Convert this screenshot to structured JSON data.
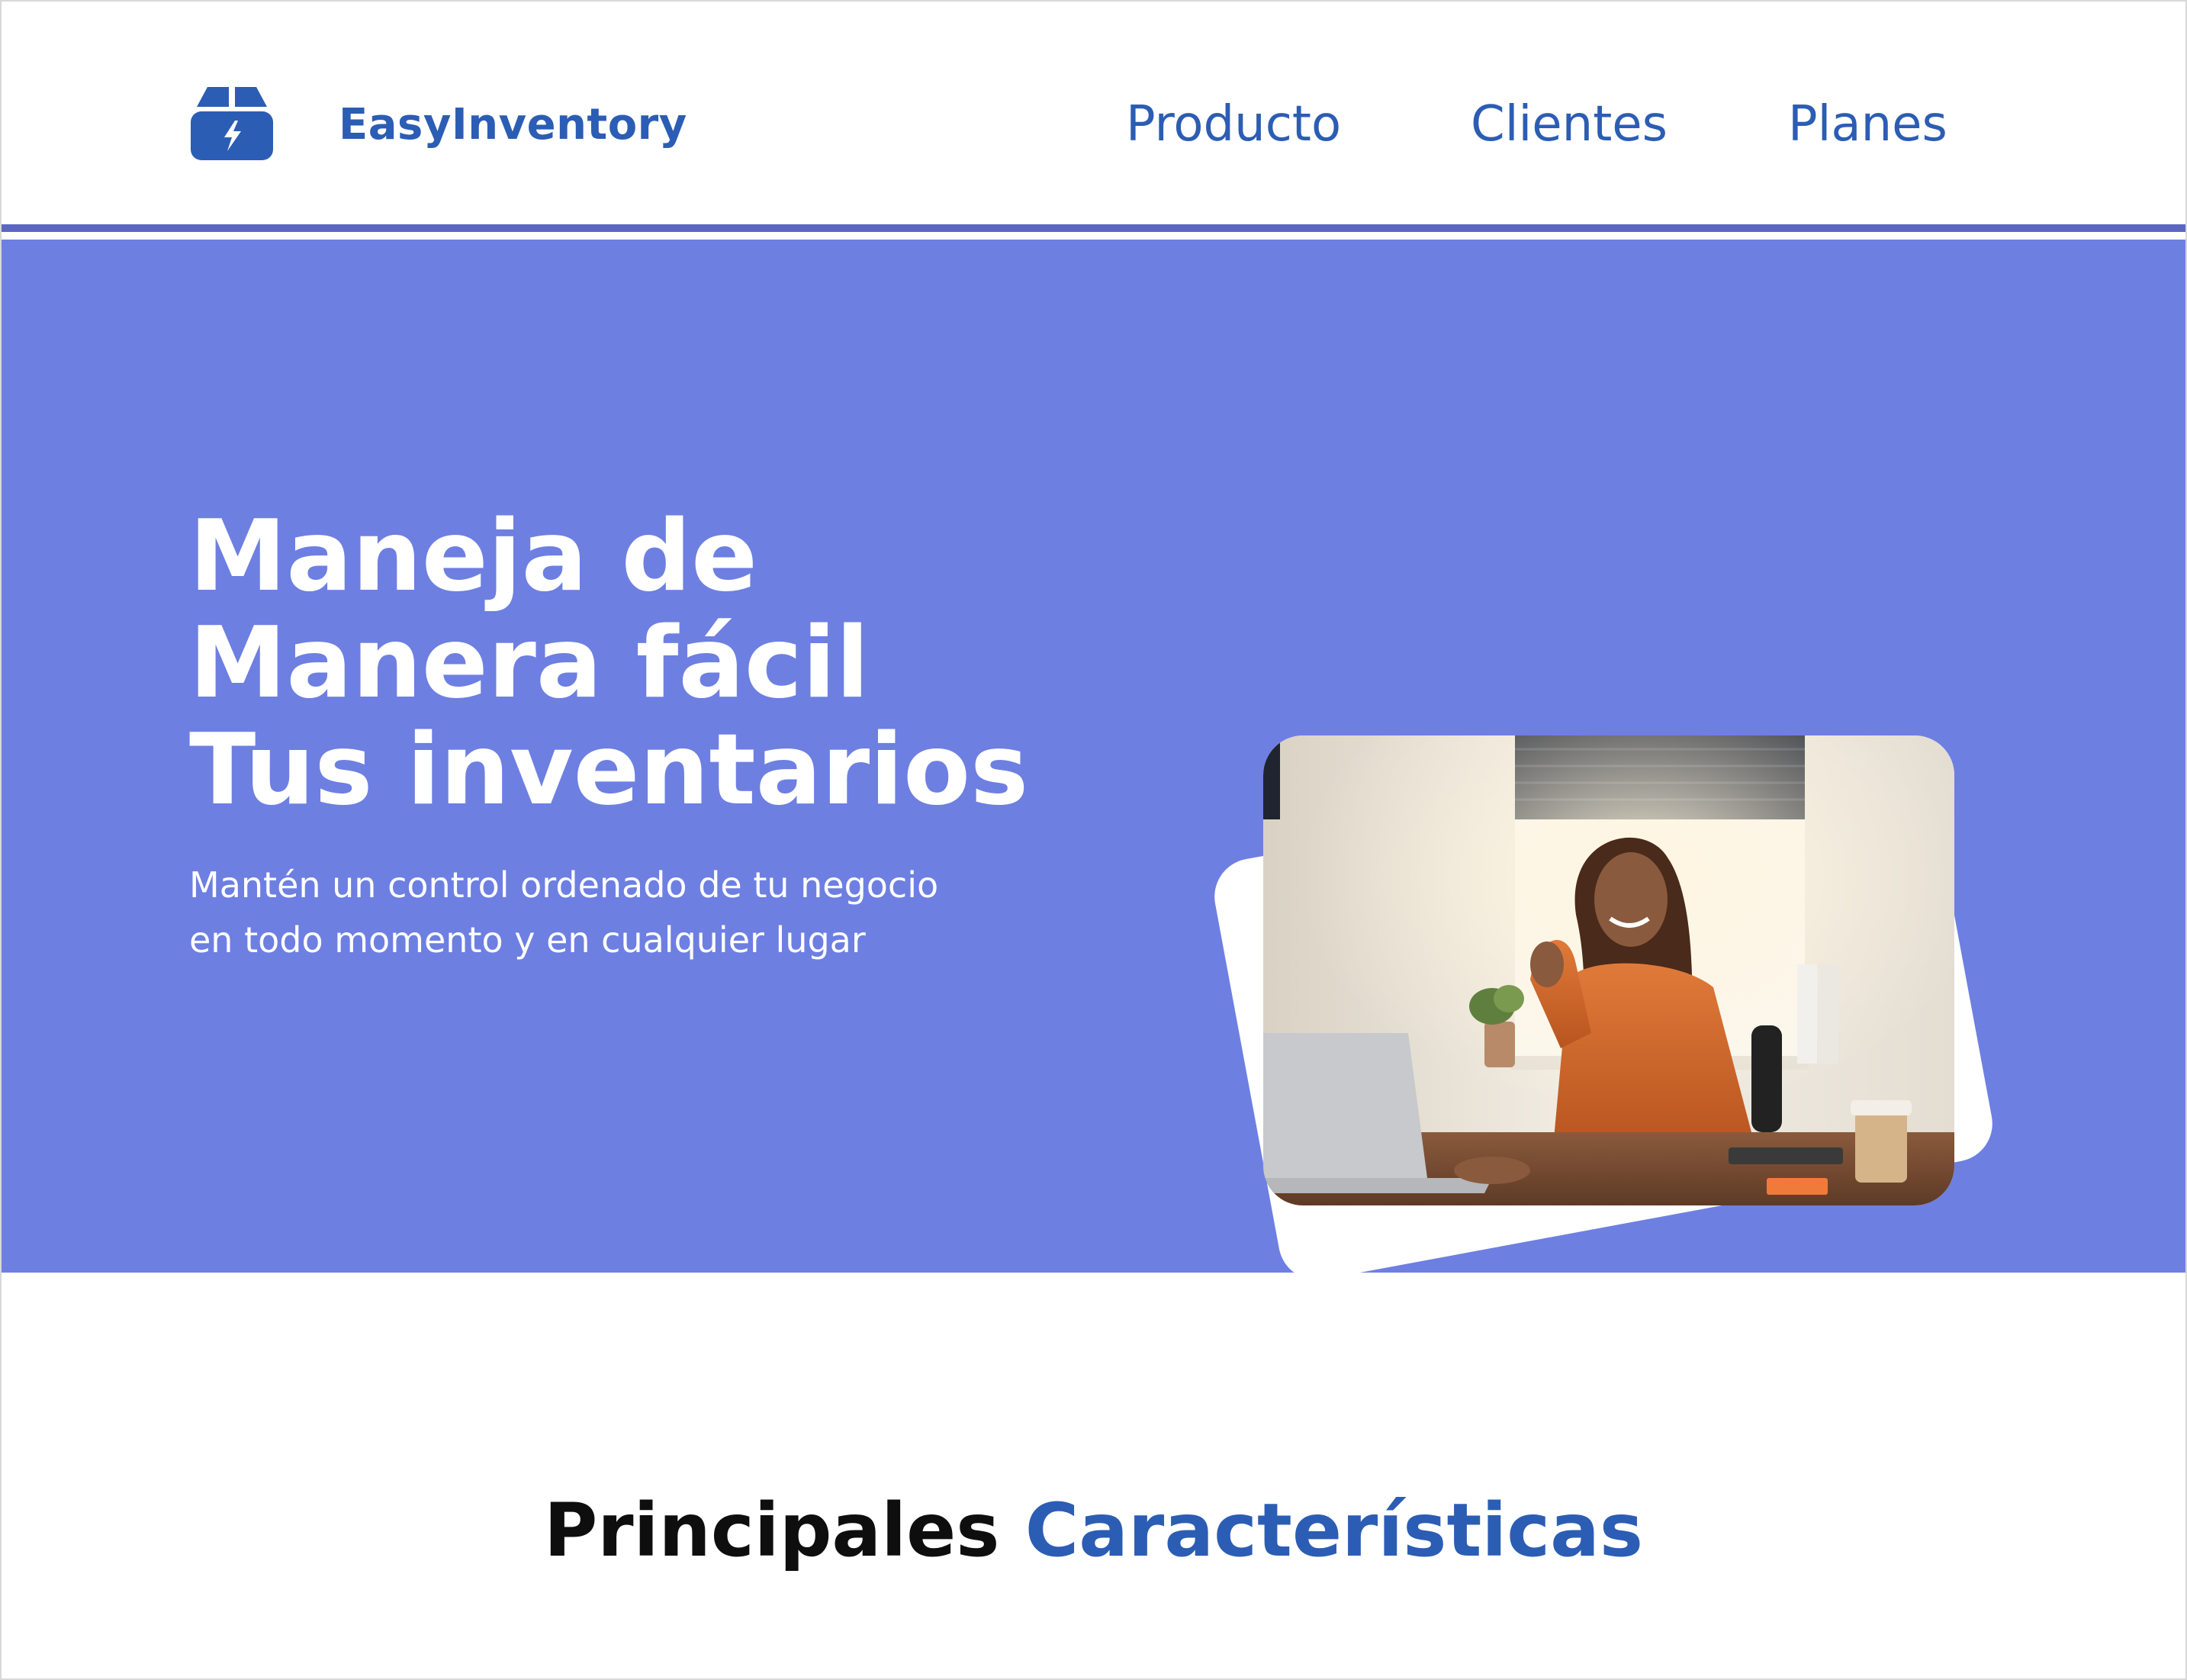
{
  "header": {
    "brand": "EasyInventory",
    "logo_icon": "box-bolt-icon",
    "nav": [
      {
        "label": "Producto"
      },
      {
        "label": "Clientes"
      },
      {
        "label": "Planes"
      }
    ]
  },
  "hero": {
    "title_lines": [
      "Maneja de",
      "Manera fácil",
      "Tus inventarios"
    ],
    "subtitle_lines": [
      "Mantén un control ordenado de tu negocio",
      "en todo momento y en cualquier lugar"
    ],
    "image_subject": "smiling woman working on laptop at desk"
  },
  "features": {
    "title_part1": "Principales",
    "title_part2": "Características"
  },
  "colors": {
    "brand_blue": "#2c5db4",
    "hero_bg": "#6e7fe2",
    "header_border": "#5b66c2",
    "text_dark": "#0e0e0e",
    "white": "#ffffff"
  }
}
